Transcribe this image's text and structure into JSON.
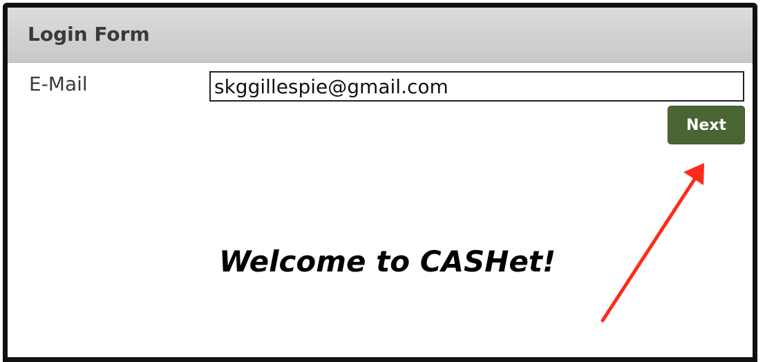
{
  "form": {
    "title": "Login Form",
    "email_label": "E-Mail",
    "email_value": "skggillespie@gmail.com",
    "next_label": "Next",
    "welcome_text": "Welcome to CASHet!"
  },
  "colors": {
    "header_bg": "#d3d3d3",
    "button_bg": "#4a6533",
    "annotation_arrow": "#ff2a1a",
    "frame_border": "#111111"
  },
  "annotation": {
    "icon": "red-arrow-icon"
  }
}
